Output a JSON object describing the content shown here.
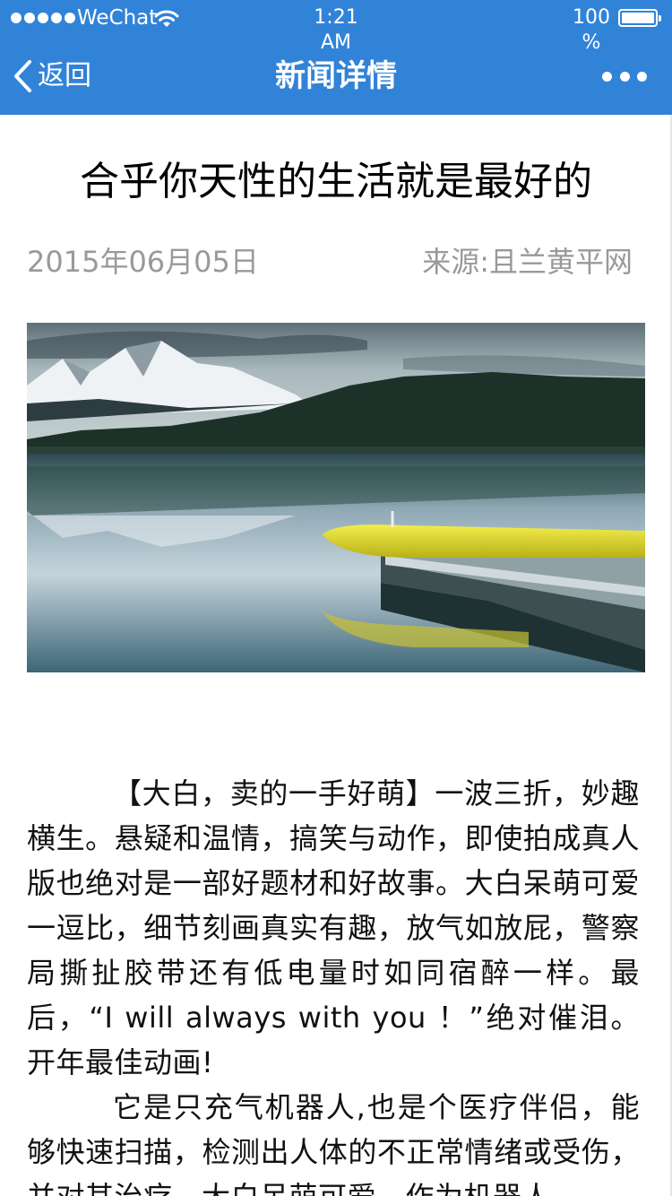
{
  "status_bar": {
    "carrier": "WeChat",
    "time": "1:21 AM",
    "battery": "100 %",
    "icons": [
      "signal-dots-icon",
      "wifi-icon",
      "battery-icon"
    ]
  },
  "nav": {
    "back_label": "返回",
    "title": "新闻详情",
    "icons": [
      "chevron-left-icon",
      "more-dots-icon"
    ]
  },
  "article": {
    "title": "合乎你天性的生活就是最好的",
    "date": "2015年06月05日",
    "source": "来源:且兰黄平网",
    "image_description_icon": "lake-kayak-photo",
    "paragraphs": [
      "【大白，卖的一手好萌】一波三折，妙趣横生。悬疑和温情，搞笑与动作，即使拍成真人版也绝对是一部好题材和好故事。大白呆萌可爱一逗比，细节刻画真实有趣，放气如放屁，警察局撕扯胶带还有低电量时如同宿醉一样。最后，“I will always with you ！”绝对催泪。开年最佳动画!",
      "它是只充气机器人,也是个医疗伴侣，能够快速扫描，检测出人体的不正常情绪或受伤，并对其治疗。大白呆萌可爱，作为机器人"
    ]
  },
  "colors": {
    "header_bg": "#3183d8",
    "header_text": "#ffffff",
    "meta_text": "#999999",
    "body_text": "#111111"
  }
}
